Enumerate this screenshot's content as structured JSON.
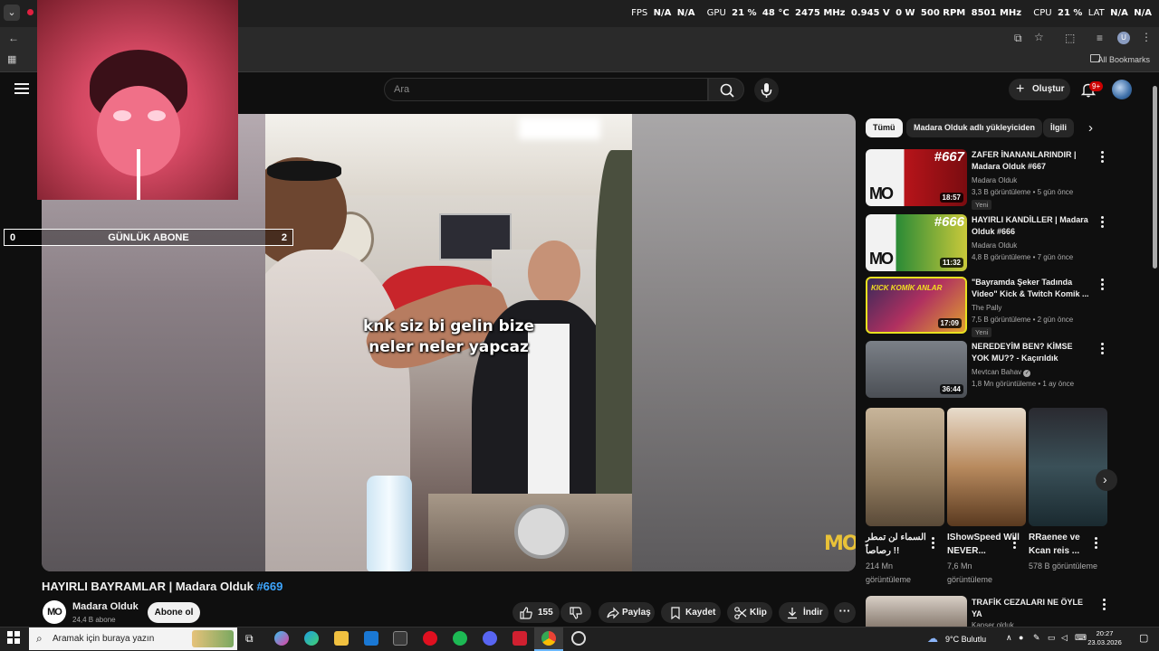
{
  "overlay": {
    "fps_label": "FPS",
    "fps_value_1": "N/A",
    "fps_value_2": "N/A",
    "gpu_label": "GPU",
    "gpu_usage": "21 %",
    "gpu_temp": "48 °C",
    "gpu_clock": "2475 MHz",
    "gpu_voltage": "0.945 V",
    "gpu_power": "0 W",
    "fan_rpm": "500 RPM",
    "mem_clock": "8501 MHz",
    "cpu_label": "CPU",
    "cpu_usage": "21 %",
    "lat_label": "LAT",
    "lat_value_1": "N/A",
    "lat_value_2": "N/A",
    "daily_left": "0",
    "daily_label": "GÜNLÜK ABONE",
    "daily_right": "2"
  },
  "browser": {
    "all_bookmarks": "All Bookmarks",
    "profile_initial": "U"
  },
  "header": {
    "search_placeholder": "Ara",
    "create_label": "Oluştur",
    "notif_badge": "9+"
  },
  "video": {
    "subtitle_line1": "knk siz bi gelin bize",
    "subtitle_line2": "neler neler yapcaz",
    "logo_mark": "MO",
    "title_main": "HAYIRLI BAYRAMLAR | Madara Olduk",
    "title_tag": "#669",
    "channel_name": "Madara Olduk",
    "channel_subs": "24,4 B abone",
    "channel_avatar_text": "MO",
    "subscribe_label": "Abone ol",
    "like_count": "155",
    "share_label": "Paylaş",
    "save_label": "Kaydet",
    "clip_label": "Klip",
    "download_label": "İndir"
  },
  "chips": [
    "Tümü",
    "Madara Olduk adlı yükleyiciden",
    "İlgili"
  ],
  "recommendations": [
    {
      "title": "ZAFER İNANANLARINDIR | Madara Olduk #667",
      "channel": "Madara Olduk",
      "meta": "3,3 B görüntüleme • 5 gün önce",
      "badge": "Yeni",
      "duration": "18:57",
      "thumb_num": "#667"
    },
    {
      "title": "HAYIRLI KANDİLLER | Madara Olduk #666",
      "channel": "Madara Olduk",
      "meta": "4,8 B görüntüleme • 7 gün önce",
      "badge": "",
      "duration": "11:32",
      "thumb_num": "#666"
    },
    {
      "title": "\"Bayramda Şeker Tadında Video\" Kick & Twitch Komik ...",
      "channel": "The Pally",
      "meta": "7,5 B görüntüleme • 2 gün önce",
      "badge": "Yeni",
      "duration": "17:09",
      "thumb_num": "KICK KOMİK ANLAR"
    },
    {
      "title": "NEREDEYİM BEN? KİMSE YOK MU?? - Kaçırıldık",
      "channel": "Mevtcan Bahav",
      "meta": "1,8 Mn görüntüleme • 1 ay önce",
      "badge": "",
      "duration": "36:44",
      "thumb_num": ""
    }
  ],
  "shorts": [
    {
      "title": "السماء لن تمطر رصاصاً !!",
      "views": "214 Mn görüntüleme"
    },
    {
      "title": "IShowSpeed Will NEVER...",
      "views": "7,6 Mn görüntüleme"
    },
    {
      "title": "RRaenee ve Kcan reis ...",
      "views": "578 B görüntüleme"
    }
  ],
  "next_rec": {
    "title": "TRAFİK CEZALARI NE ÖYLE YA",
    "channel": "Kanser olduk"
  },
  "taskbar": {
    "search_placeholder": "Aramak için buraya yazın",
    "weather": "9°C  Bulutlu",
    "time": "20:27",
    "date": "23.03.2026"
  },
  "colors": {
    "accent_blue": "#3ea6ff",
    "brand_red": "#cc0000",
    "bg": "#0f0f0f"
  }
}
